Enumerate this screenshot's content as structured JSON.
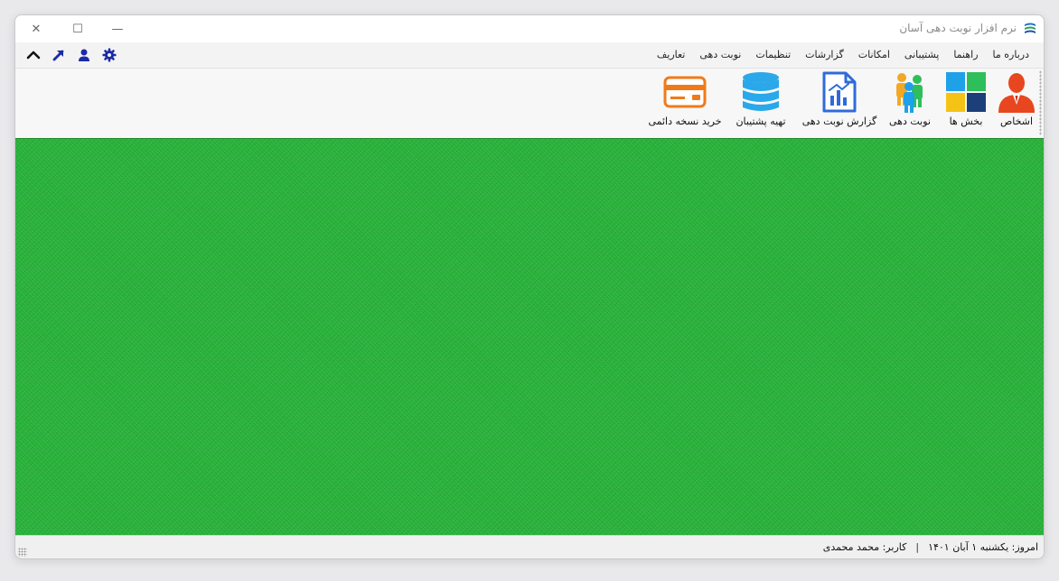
{
  "window": {
    "title": "نرم افزار نوبت دهی آسان",
    "controls": {
      "minimize": "—",
      "maximize": "☐",
      "close": "✕"
    }
  },
  "menu": {
    "items": [
      {
        "label": "تعاریف"
      },
      {
        "label": "نوبت دهی"
      },
      {
        "label": "تنظیمات"
      },
      {
        "label": "گزارشات"
      },
      {
        "label": "امکانات"
      },
      {
        "label": "پشتیبانی"
      },
      {
        "label": "راهنما"
      },
      {
        "label": "درباره ما"
      }
    ],
    "quick_icons": [
      "gear-icon",
      "user-icon",
      "arrow-up-right-icon",
      "chevron-up-icon"
    ],
    "quick_icon_color": "#1b2aa8"
  },
  "toolbar": {
    "items": [
      {
        "label": "اشخاص",
        "icon": "person-icon",
        "color": "#e8461f"
      },
      {
        "label": "بخش ها",
        "icon": "tiles-icon",
        "color": "#1ea1e8"
      },
      {
        "label": "نوبت دهی",
        "icon": "people-group-icon",
        "color": "#f2a825"
      },
      {
        "label": "گزارش نوبت دهی",
        "icon": "report-chart-icon",
        "color": "#2f6bd8"
      },
      {
        "label": "تهیه پشتیبان",
        "icon": "database-icon",
        "color": "#2aa8ea"
      },
      {
        "label": "خرید نسخه دائمی",
        "icon": "credit-card-icon",
        "color": "#f07a1a"
      }
    ]
  },
  "main": {
    "background_color": "#2ab53c"
  },
  "status": {
    "date": "امروز: یکشنبه ۱ آبان ۱۴۰۱",
    "separator": "|",
    "user": "کاربر: محمد محمدی"
  }
}
